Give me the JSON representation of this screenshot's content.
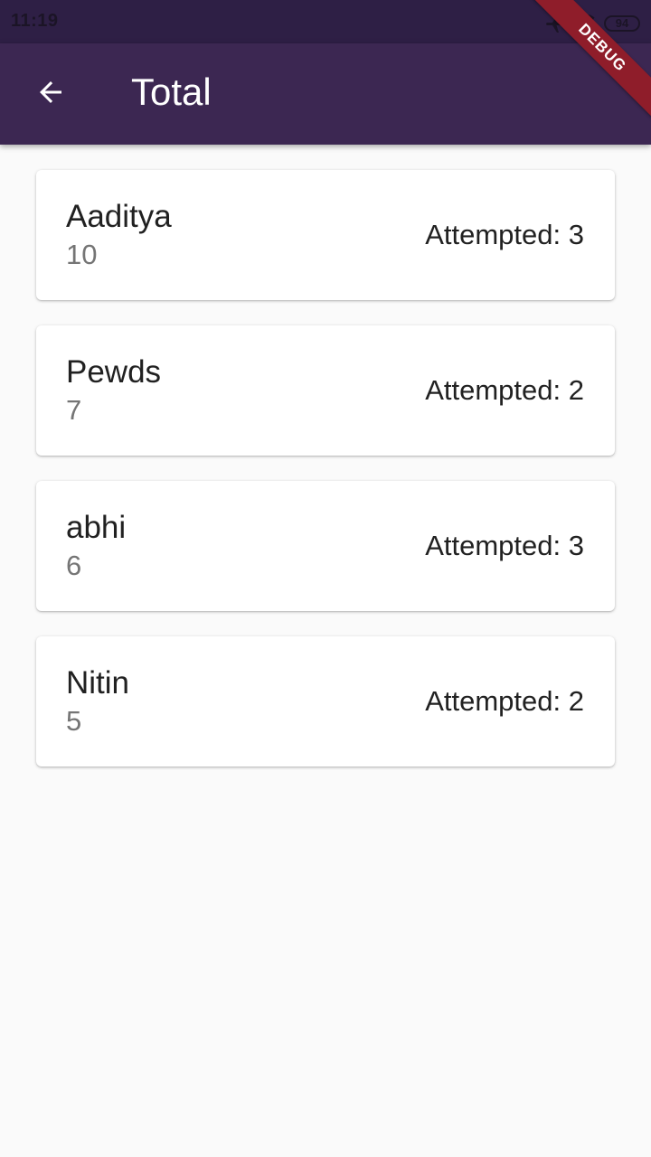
{
  "status_bar": {
    "time": "11:19",
    "battery": "94",
    "icons": [
      "airplane-icon",
      "wifi-icon",
      "battery-icon"
    ]
  },
  "app_bar": {
    "title": "Total",
    "back_icon": "arrow-back-icon",
    "background": "#3c2752"
  },
  "debug_banner": "DEBUG",
  "entries": [
    {
      "name": "Aaditya",
      "score": "10",
      "attempted": "Attempted: 3"
    },
    {
      "name": "Pewds",
      "score": "7",
      "attempted": "Attempted: 2"
    },
    {
      "name": "abhi",
      "score": "6",
      "attempted": "Attempted: 3"
    },
    {
      "name": "Nitin",
      "score": "5",
      "attempted": "Attempted: 2"
    }
  ]
}
